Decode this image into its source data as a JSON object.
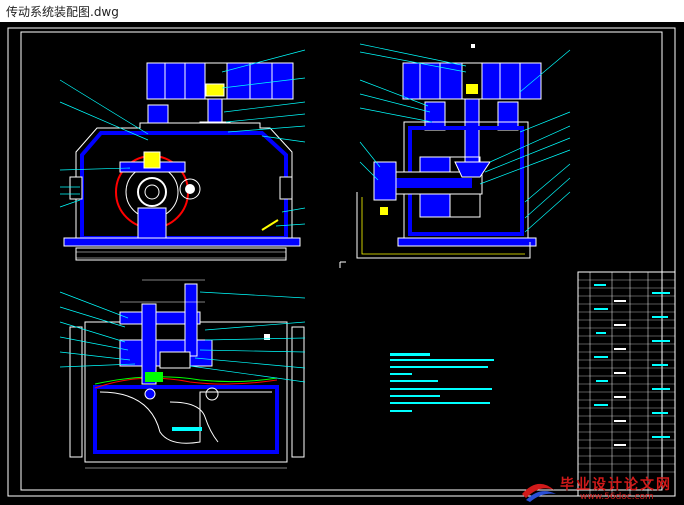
{
  "window": {
    "title": "传动系统装配图.dwg"
  },
  "colors": {
    "background": "#000000",
    "line": "#ffffff",
    "housing": "#0000ff",
    "annotation": "#00ffff",
    "accent_red": "#ff0000",
    "accent_green": "#00ff00",
    "accent_yellow": "#ffff00"
  },
  "watermark": {
    "text": "毕业设计论文网",
    "url": "www.56doc.com"
  }
}
